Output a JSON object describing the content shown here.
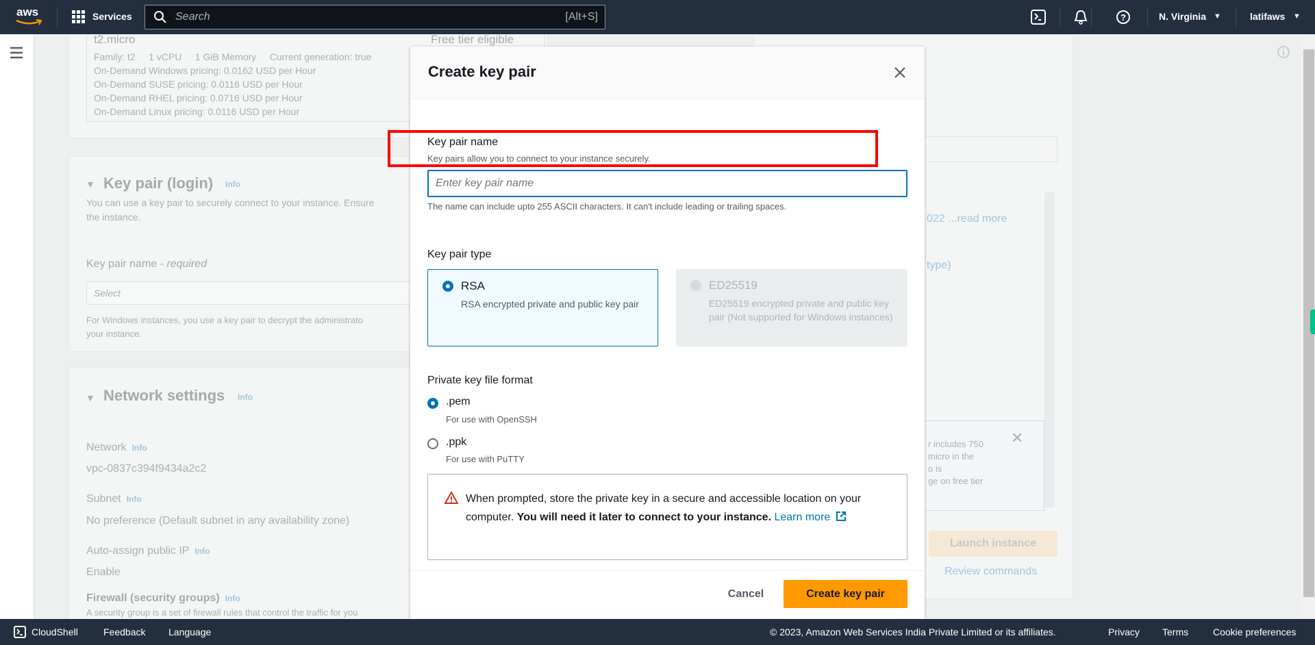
{
  "topbar": {
    "logo": "aws",
    "services": "Services",
    "search_placeholder": "Search",
    "search_shortcut": "[Alt+S]",
    "region": "N. Virginia",
    "user": "latifaws",
    "icons": [
      "cloudshell-icon",
      "bell-icon",
      "help-icon"
    ]
  },
  "background": {
    "instance": {
      "name": "t2.micro",
      "free_tier": "Free tier eligible",
      "lines": [
        "Family: t2     1 vCPU     1 GiB Memory     Current generation: true",
        "On-Demand Windows pricing: 0.0162 USD per Hour",
        "On-Demand SUSE pricing: 0.0116 USD per Hour",
        "On-Demand RHEL pricing: 0.0716 USD per Hour",
        "On-Demand Linux pricing: 0.0116 USD per Hour"
      ]
    },
    "keypair": {
      "title": "Key pair (login)",
      "info": "Info",
      "desc1": "You can use a key pair to securely connect to your instance. Ensure",
      "desc2": "the instance.",
      "field_label": "Key pair name",
      "required": " - required",
      "select": "Select",
      "windows1": "For Windows instances, you use a key pair to decrypt the administrato",
      "windows2": "your instance."
    },
    "network": {
      "title": "Network settings",
      "info": "Info",
      "network_label": "Network",
      "network_value": "vpc-0837c394f9434a2c2",
      "subnet_label": "Subnet",
      "subnet_value": "No preference (Default subnet in any availability zone)",
      "ip_label": "Auto-assign public IP",
      "ip_value": "Enable",
      "firewall_label": "Firewall (security groups)",
      "firewall_desc": "A security group is a set of firewall rules that control the traffic for you"
    },
    "summary": {
      "read_more": "022 ...read more",
      "type": "type)",
      "notice": [
        "r includes 750",
        "micro in the",
        "o is",
        "ge on free tier"
      ],
      "launch": "Launch instance",
      "review": "Review commands"
    }
  },
  "modal": {
    "title": "Create key pair",
    "name_label": "Key pair name",
    "name_desc": "Key pairs allow you to connect to your instance securely.",
    "name_placeholder": "Enter key pair name",
    "name_constraint": "The name can include upto 255 ASCII characters. It can't include leading or trailing spaces.",
    "type_label": "Key pair type",
    "types": [
      {
        "label": "RSA",
        "desc": "RSA encrypted private and public key pair",
        "selected": true,
        "disabled": false
      },
      {
        "label": "ED25519",
        "desc": "ED25519 encrypted private and public key pair (Not supported for Windows instances)",
        "selected": false,
        "disabled": true
      }
    ],
    "format_label": "Private key file format",
    "formats": [
      {
        "label": ".pem",
        "desc": "For use with OpenSSH",
        "selected": true
      },
      {
        "label": ".ppk",
        "desc": "For use with PuTTY",
        "selected": false
      }
    ],
    "warning_text": "When prompted, store the private key in a secure and accessible location on your computer. ",
    "warning_bold": "You will need it later to connect to your instance.",
    "warning_link": "Learn more",
    "cancel": "Cancel",
    "create": "Create key pair"
  },
  "footer": {
    "cloudshell": "CloudShell",
    "feedback": "Feedback",
    "language": "Language",
    "copyright": "© 2023, Amazon Web Services India Private Limited or its affiliates.",
    "privacy": "Privacy",
    "terms": "Terms",
    "cookies": "Cookie preferences"
  },
  "colors": {
    "accent": "#0073bb",
    "primary_button": "#ff9900",
    "highlight": "#ff0000",
    "nav": "#232f3e"
  }
}
